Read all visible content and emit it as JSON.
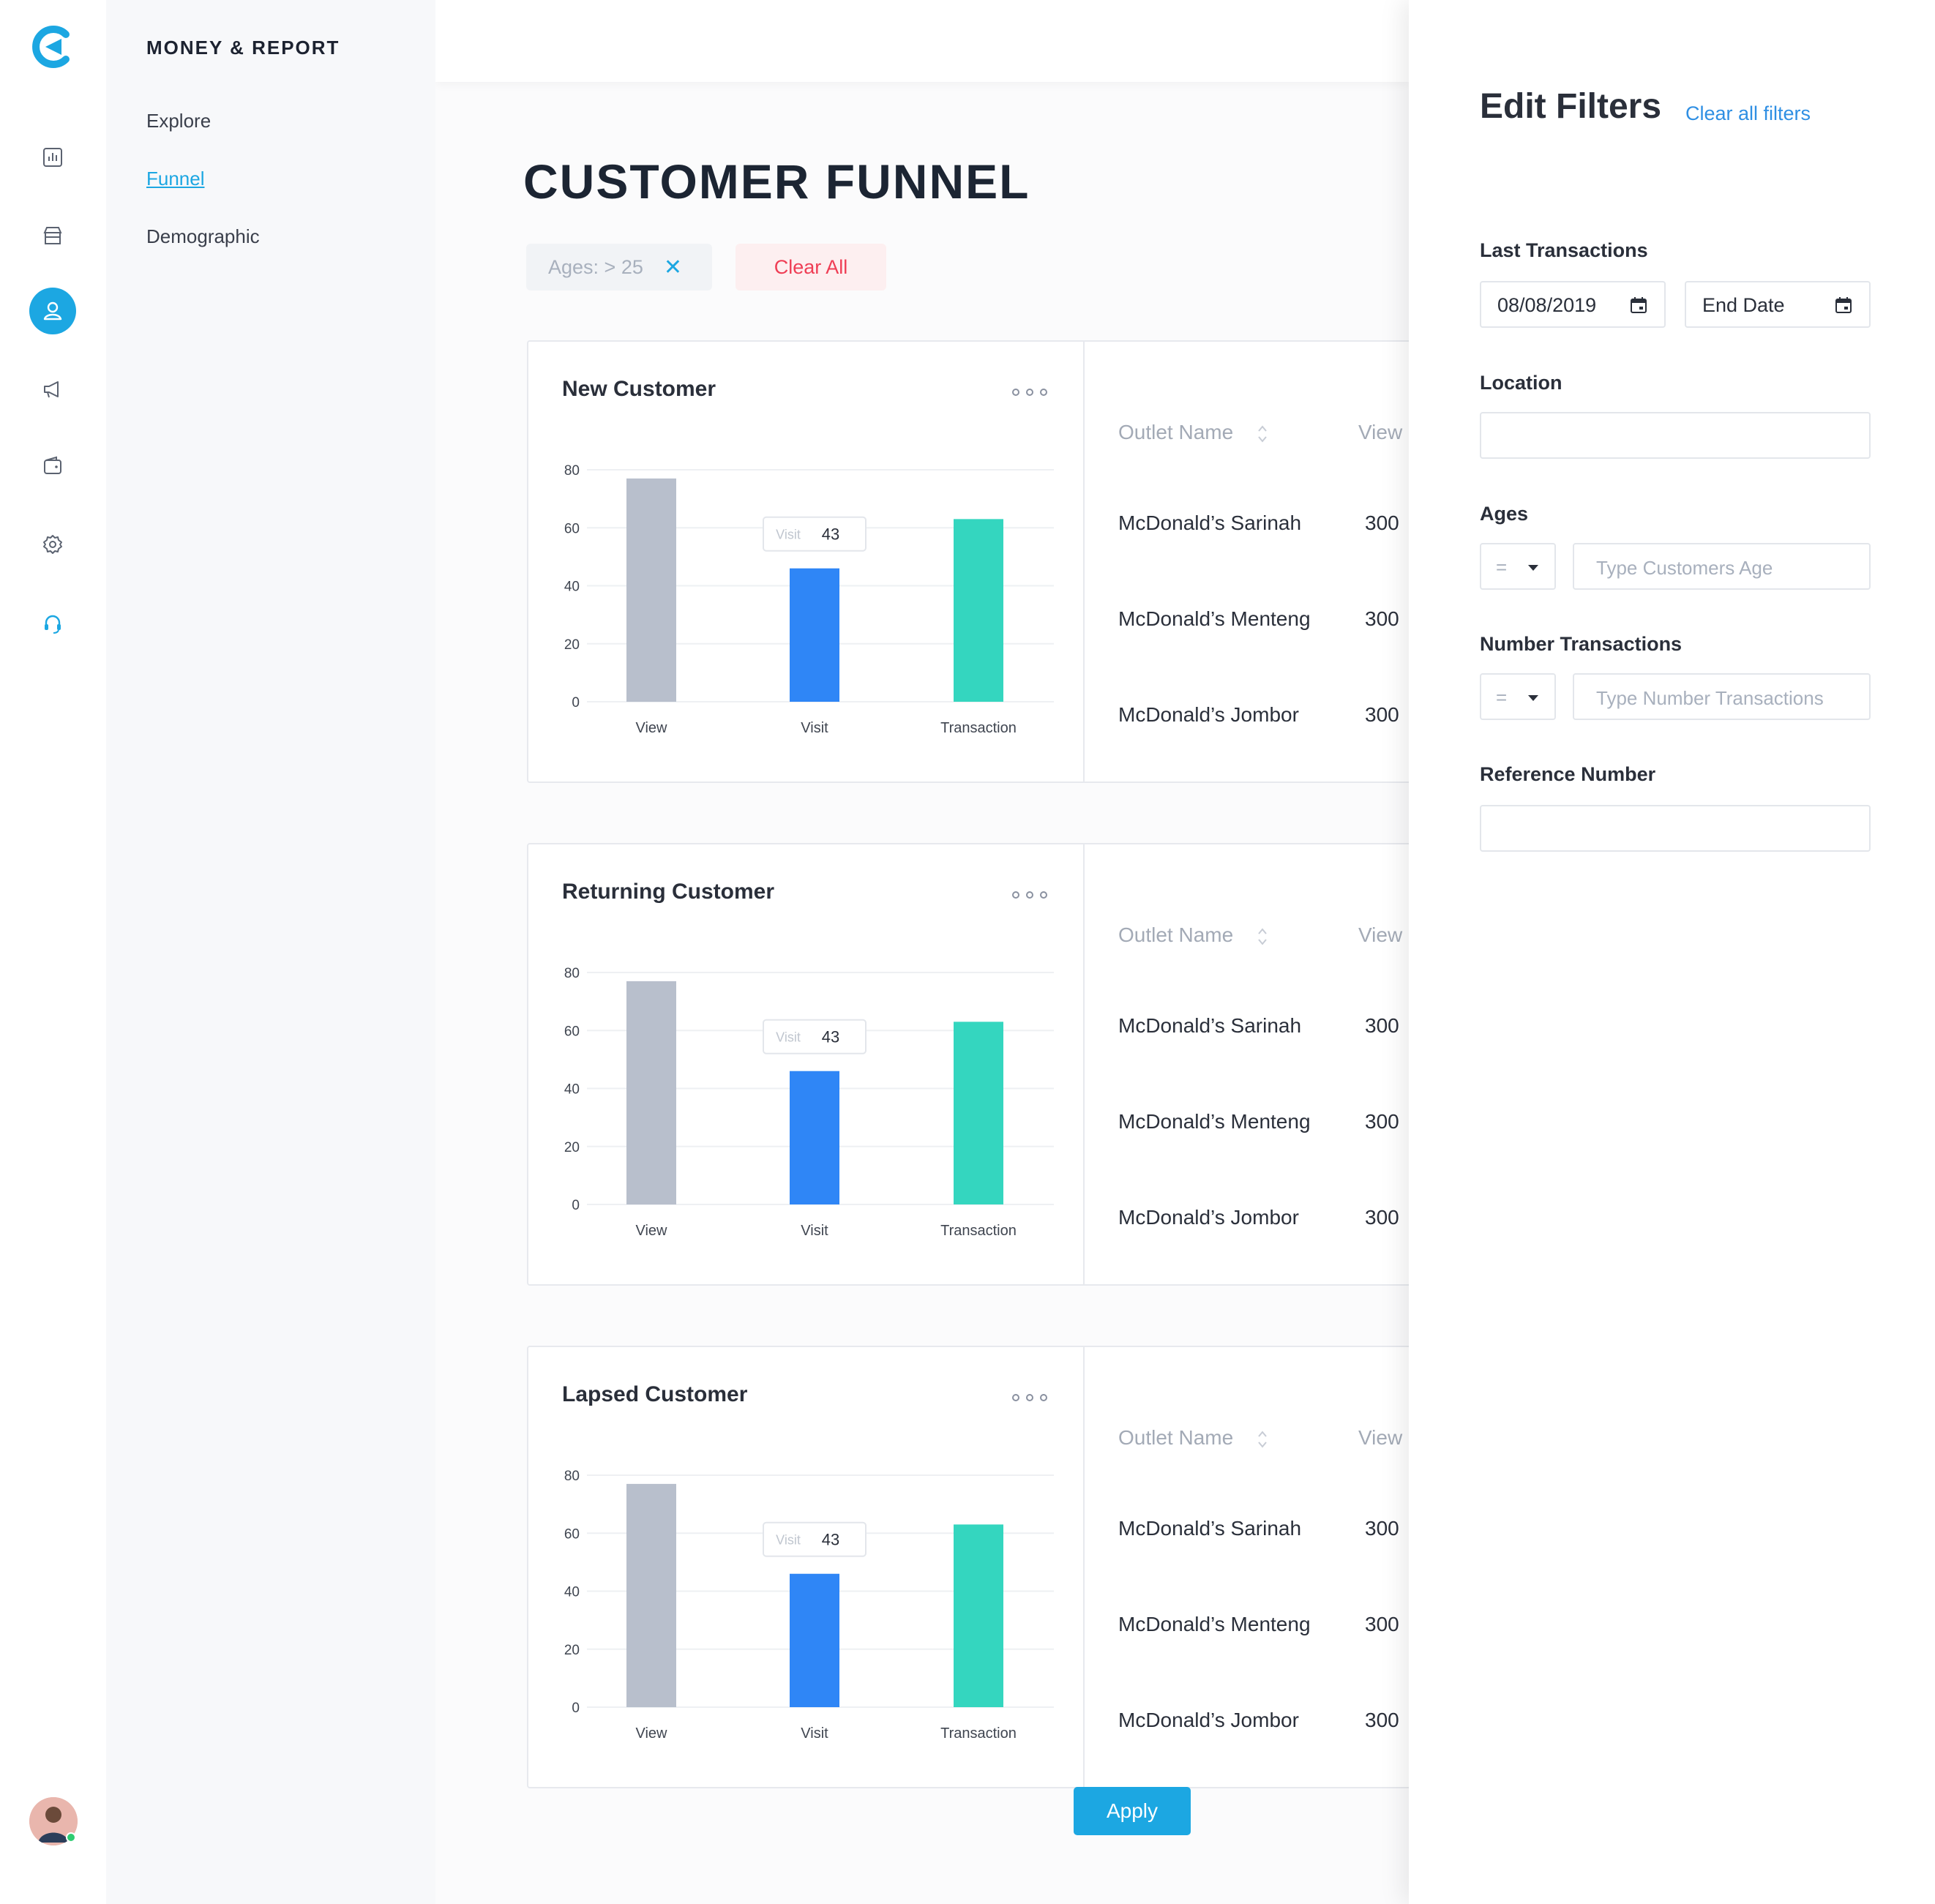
{
  "rail": {
    "items": [
      {
        "name": "reports-icon"
      },
      {
        "name": "store-icon"
      },
      {
        "name": "customer-icon",
        "active": true
      },
      {
        "name": "megaphone-icon"
      },
      {
        "name": "wallet-icon"
      },
      {
        "name": "settings-icon"
      },
      {
        "name": "support-headset-icon"
      }
    ],
    "accent": "#1ca7e2"
  },
  "submenu": {
    "title": "MONEY & REPORT",
    "items": [
      {
        "label": "Explore",
        "active": false
      },
      {
        "label": "Funnel",
        "active": true
      },
      {
        "label": "Demographic",
        "active": false
      }
    ]
  },
  "main": {
    "title": "CUSTOMER FUNNEL",
    "chips": {
      "age": "Ages: > 25",
      "clear_all": "Clear All"
    },
    "cards": [
      {
        "title": "New Customer",
        "table": {
          "headers": [
            "Outlet Name",
            "View"
          ],
          "rows": [
            {
              "outlet": "McDonald’s Sarinah",
              "view": "300"
            },
            {
              "outlet": "McDonald’s Menteng",
              "view": "300"
            },
            {
              "outlet": "McDonald’s Jombor",
              "view": "300"
            }
          ]
        }
      },
      {
        "title": "Returning Customer",
        "table": {
          "headers": [
            "Outlet Name",
            "View"
          ],
          "rows": [
            {
              "outlet": "McDonald’s Sarinah",
              "view": "300"
            },
            {
              "outlet": "McDonald’s Menteng",
              "view": "300"
            },
            {
              "outlet": "McDonald’s Jombor",
              "view": "300"
            }
          ]
        }
      },
      {
        "title": "Lapsed Customer",
        "table": {
          "headers": [
            "Outlet Name",
            "View"
          ],
          "rows": [
            {
              "outlet": "McDonald’s Sarinah",
              "view": "300"
            },
            {
              "outlet": "McDonald’s Menteng",
              "view": "300"
            },
            {
              "outlet": "McDonald’s Jombor",
              "view": "300"
            }
          ]
        }
      }
    ]
  },
  "chart_data": [
    {
      "type": "bar",
      "title": "New Customer",
      "categories": [
        "View",
        "Visit",
        "Transaction"
      ],
      "values": [
        77,
        46,
        63
      ],
      "colors": [
        "#b8bfcc",
        "#2f86f6",
        "#34d6bf"
      ],
      "ylim": [
        0,
        80
      ],
      "yticks": [
        "80",
        "60",
        "40",
        "20",
        "0"
      ],
      "tooltip": {
        "label": "Visit",
        "value": "43"
      },
      "grid": true
    },
    {
      "type": "bar",
      "title": "Returning Customer",
      "categories": [
        "View",
        "Visit",
        "Transaction"
      ],
      "values": [
        77,
        46,
        63
      ],
      "colors": [
        "#b8bfcc",
        "#2f86f6",
        "#34d6bf"
      ],
      "ylim": [
        0,
        80
      ],
      "yticks": [
        "80",
        "60",
        "40",
        "20",
        "0"
      ],
      "tooltip": {
        "label": "Visit",
        "value": "43"
      },
      "grid": true
    },
    {
      "type": "bar",
      "title": "Lapsed Customer",
      "categories": [
        "View",
        "Visit",
        "Transaction"
      ],
      "values": [
        77,
        46,
        63
      ],
      "colors": [
        "#b8bfcc",
        "#2f86f6",
        "#34d6bf"
      ],
      "ylim": [
        0,
        80
      ],
      "yticks": [
        "80",
        "60",
        "40",
        "20",
        "0"
      ],
      "tooltip": {
        "label": "Visit",
        "value": "43"
      },
      "grid": true
    }
  ],
  "filters": {
    "title": "Edit Filters",
    "clear_all": "Clear all filters",
    "last_transactions": {
      "label": "Last Transactions",
      "start": "08/08/2019",
      "end_placeholder": "End Date"
    },
    "location": {
      "label": "Location",
      "value": ""
    },
    "ages": {
      "label": "Ages",
      "operator": "=",
      "placeholder": "Type Customers Age"
    },
    "number_transactions": {
      "label": "Number Transactions",
      "operator": "=",
      "placeholder": "Type Number Transactions"
    },
    "reference_number": {
      "label": "Reference Number",
      "value": ""
    },
    "apply": "Apply"
  }
}
